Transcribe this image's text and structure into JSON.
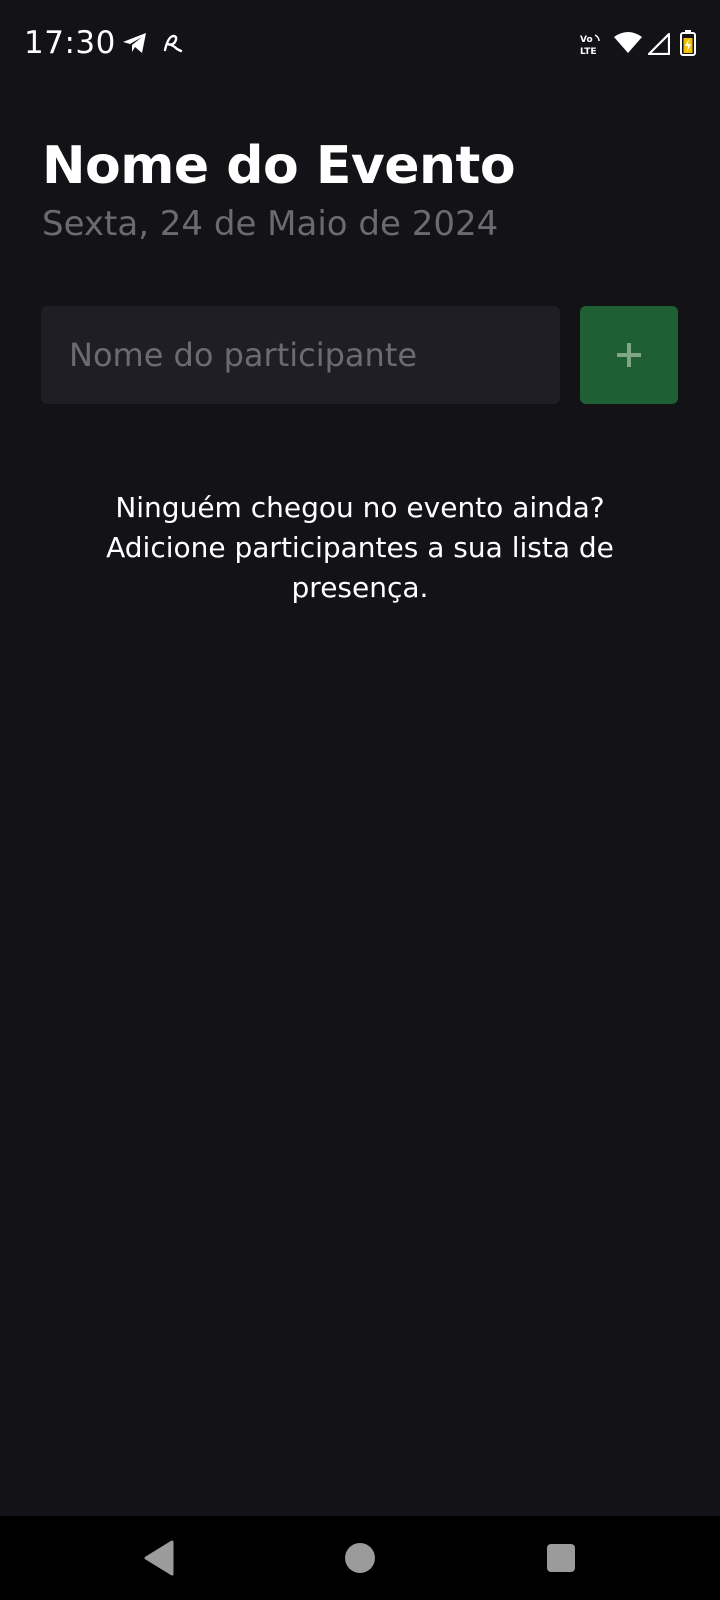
{
  "status_bar": {
    "time": "17:30",
    "icons": [
      "telegram-icon",
      "app-notification-icon",
      "volte-icon",
      "wifi-icon",
      "signal-icon",
      "battery-icon"
    ],
    "volte_label_top": "Vo",
    "volte_label_bottom": "LTE"
  },
  "event": {
    "title": "Nome do Evento",
    "date": "Sexta, 24 de Maio de 2024"
  },
  "participant_form": {
    "input_value": "",
    "input_placeholder": "Nome do participante",
    "add_button_label": "+"
  },
  "empty_state": {
    "message": "Ninguém chegou no evento ainda? Adicione participantes a sua lista de presença."
  },
  "nav_bar": {
    "icons": [
      "back-icon",
      "home-icon",
      "recents-icon"
    ]
  },
  "colors": {
    "background": "#131216",
    "input_background": "#1f1e25",
    "add_button": "#1f5f34",
    "subtitle": "#6a6a70",
    "nav_background": "#000000"
  }
}
